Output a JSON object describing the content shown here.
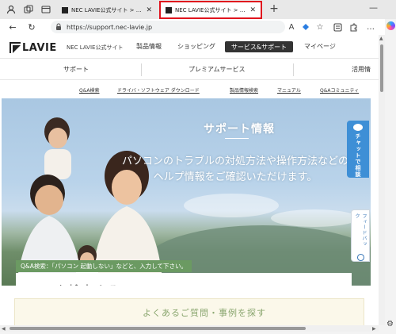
{
  "browser": {
    "tabs": [
      {
        "title": "NEC LAVIE公式サイト > サービス&サポート",
        "active": false
      },
      {
        "title": "NEC LAVIE公式サイト > サービス&サポート",
        "active": true
      }
    ],
    "new_tab": "+",
    "url": "https://support.nec-lavie.jp",
    "icons": {
      "profile": "profile-icon",
      "workspaces": "workspaces-icon",
      "tab_actions": "tab-actions-icon",
      "minimize": "—",
      "back": "←",
      "reload": "↻",
      "lock": "lock-icon",
      "read_aloud": "A",
      "favorite": "☆",
      "collections": "collections-icon",
      "extensions": "extensions-icon",
      "more": "…",
      "copilot": "copilot-icon",
      "settings": "⚙"
    },
    "highlight_color": "#e0141e"
  },
  "site": {
    "logo": "LAVIE",
    "site_name": "NEC LAVIE公式サイト",
    "global_nav": [
      "製品情報",
      "ショッピング",
      "サービス&サポート",
      "マイページ"
    ],
    "sub_nav": [
      "サポート",
      "プレミアムサービス",
      "活用情"
    ],
    "quick_links": [
      "Q&A検索",
      "ドライバ・ソフトウェア ダウンロード",
      "製品情報検索",
      "マニュアル",
      "Q&Aコミュニティ"
    ]
  },
  "hero": {
    "title": "サポート情報",
    "desc_line1": "パソコンのトラブルの対処方法や操作方法などの",
    "desc_line2": "ヘルプ情報をご確認いただけます。",
    "search_hint": "Q&A検索：「パソコン 起動しない」などと、入力して下さい。",
    "search_placeholder": "Q&Aを検索する",
    "chat_tab": "チャットで相談",
    "feedback_tab": "フィードバック",
    "accent_color": "#3e8fd6",
    "hint_color": "#6b9a62"
  },
  "below": {
    "faq_title": "よくあるご質問・事例を探す"
  }
}
